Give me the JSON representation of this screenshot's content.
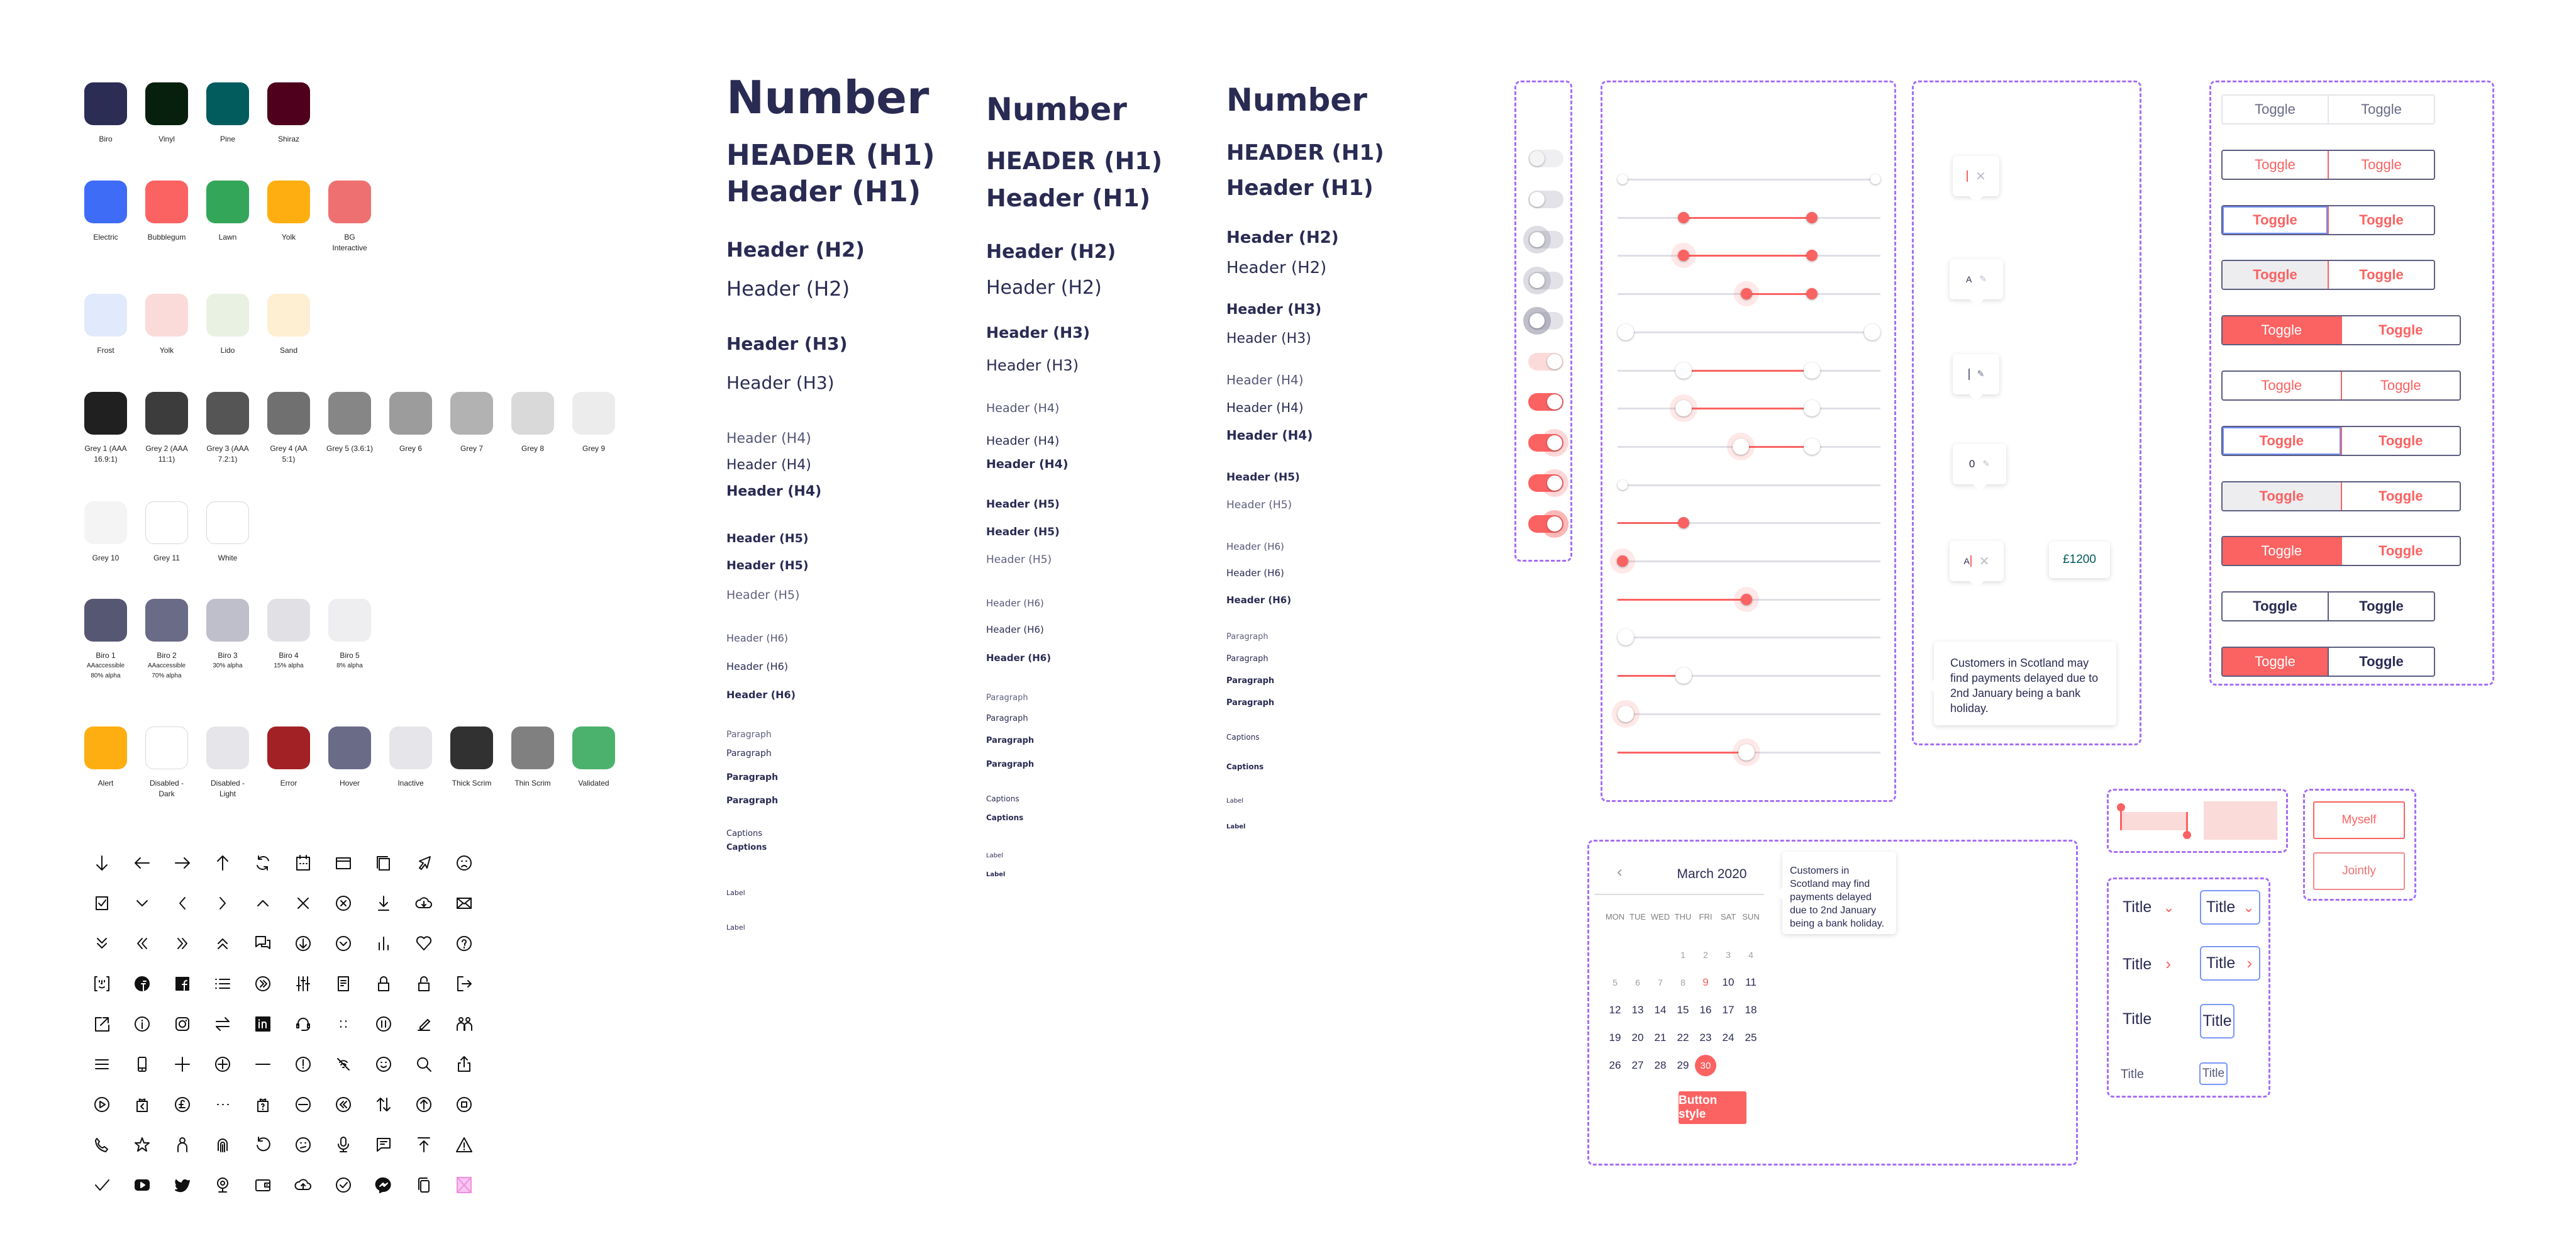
{
  "palette": {
    "brand": [
      {
        "name": "Biro",
        "color": "#2b2d54"
      },
      {
        "name": "Vinyl",
        "color": "#07200d"
      },
      {
        "name": "Pine",
        "color": "#025b5d"
      },
      {
        "name": "Shiraz",
        "color": "#4f001d"
      }
    ],
    "accents": [
      {
        "name": "Electric",
        "color": "#3e6cf7"
      },
      {
        "name": "Bubblegum",
        "color": "#fb6262"
      },
      {
        "name": "Lawn",
        "color": "#34a659"
      },
      {
        "name": "Yolk",
        "color": "#feae10"
      },
      {
        "name": "BG Interactive",
        "color": "#ee7070"
      }
    ],
    "tints": [
      {
        "name": "Frost",
        "color": "#e1e9fc"
      },
      {
        "name": "Yolk",
        "color": "#fadbd9"
      },
      {
        "name": "Lido",
        "color": "#e8f1e2"
      },
      {
        "name": "Sand",
        "color": "#feefd2"
      }
    ],
    "greys": [
      {
        "name": "Grey 1 (AAA 16.9:1)",
        "color": "#202020"
      },
      {
        "name": "Grey 2 (AAA 11:1)",
        "color": "#3c3c3c"
      },
      {
        "name": "Grey 3 (AAA 7.2:1)",
        "color": "#555555"
      },
      {
        "name": "Grey 4 (AA 5:1)",
        "color": "#707070"
      },
      {
        "name": "Grey 5 (3.6:1)",
        "color": "#868686"
      },
      {
        "name": "Grey 6",
        "color": "#9c9c9c"
      },
      {
        "name": "Grey 7",
        "color": "#b2b2b2"
      },
      {
        "name": "Grey 8",
        "color": "#d9d9d9"
      },
      {
        "name": "Grey 9",
        "color": "#ececec"
      }
    ],
    "greys2": [
      {
        "name": "Grey 10",
        "color": "#f4f4f4"
      },
      {
        "name": "Grey 11",
        "color": "#ffffff",
        "outline": true
      },
      {
        "name": "White",
        "color": "#ffffff",
        "outline": true
      }
    ],
    "biros": [
      {
        "name": "Biro 1",
        "sub1": "AAaccessible",
        "sub2": "80% alpha",
        "color": "#565873"
      },
      {
        "name": "Biro 2",
        "sub1": "AAaccessible",
        "sub2": "70% alpha",
        "color": "#6a6b87"
      },
      {
        "name": "Biro 3",
        "sub1": "30% alpha",
        "sub2": "",
        "color": "#bfbfcb"
      },
      {
        "name": "Biro 4",
        "sub1": "15% alpha",
        "sub2": "",
        "color": "#e0e0e5"
      },
      {
        "name": "Biro 5",
        "sub1": "8% alpha",
        "sub2": "",
        "color": "#eeeef1"
      }
    ],
    "states": [
      {
        "name": "Alert",
        "color": "#feae10"
      },
      {
        "name": "Disabled - Dark",
        "color": "#ffffff",
        "outline": true
      },
      {
        "name": "Disabled - Light",
        "color": "#e5e5ea"
      },
      {
        "name": "Error",
        "color": "#a22124"
      },
      {
        "name": "Hover",
        "color": "#6a6b87"
      },
      {
        "name": "Inactive",
        "color": "#e6e6ea"
      },
      {
        "name": "Thick Scrim",
        "color": "#313131"
      },
      {
        "name": "Thin Scrim",
        "color": "#808080"
      },
      {
        "name": "Validated",
        "color": "#4ab26c"
      }
    ]
  },
  "icons": [
    "arrow-down",
    "arrow-left",
    "arrow-right",
    "arrow-up",
    "refresh",
    "calendar",
    "browser-window",
    "copy-document",
    "cursor-pointer",
    "sad-face",
    "checkbox-checked",
    "chevron-down",
    "chevron-left",
    "chevron-right",
    "chevron-up",
    "close",
    "close-circle",
    "download",
    "cloud-download",
    "mail",
    "double-chevron-down",
    "double-chevron-left",
    "double-chevron-right",
    "double-chevron-up",
    "chat",
    "arrow-down-circle",
    "chevron-down-circle",
    "bar-chart",
    "heart",
    "help-circle",
    "face-id",
    "facebook-round",
    "facebook-square",
    "list",
    "double-chevron-right-circle",
    "sliders",
    "document",
    "lock",
    "unlock",
    "logout",
    "external-link",
    "info-circle",
    "instagram",
    "transfer",
    "linkedin",
    "headset",
    "drag-handle",
    "pause-circle",
    "edit",
    "users",
    "menu",
    "mobile",
    "plus",
    "plus-circle",
    "minus",
    "alert-circle",
    "contactless-off",
    "happy-face",
    "search",
    "share",
    "play-circle",
    "gift-back",
    "pound-circle",
    "more-horizontal",
    "gift-question",
    "minus-circle",
    "rewind-circle",
    "sort",
    "arrow-up-circle",
    "stop-circle",
    "phone",
    "star",
    "user",
    "fingerprint",
    "undo",
    "neutral-face",
    "microphone",
    "message",
    "upload-top",
    "warning",
    "check",
    "youtube",
    "twitter",
    "webcam",
    "wallet",
    "cloud-upload",
    "check-circle",
    "messenger",
    "duplicate",
    "placeholder"
  ],
  "typography": {
    "col1": [
      "Number",
      "HEADER (H1)",
      "Header (H1)",
      "Header (H2)",
      "Header (H2)",
      "Header (H3)",
      "Header (H3)",
      "Header (H4)",
      "Header (H4)",
      "Header (H4)",
      "Header (H5)",
      "Header (H5)",
      "Header (H5)",
      "Header (H6)",
      "Header (H6)",
      "Header (H6)",
      "Paragraph",
      "Paragraph",
      "Paragraph",
      "Paragraph",
      "Captions",
      "Captions",
      "Label",
      "Label"
    ],
    "col2": [
      "Number",
      "HEADER (H1)",
      "Header (H1)",
      "Header (H2)",
      "Header (H2)",
      "Header (H3)",
      "Header (H3)",
      "Header (H4)",
      "Header (H4)",
      "Header (H4)",
      "Header (H5)",
      "Header (H5)",
      "Header (H5)",
      "Header (H6)",
      "Header (H6)",
      "Header (H6)",
      "Paragraph",
      "Paragraph",
      "Paragraph",
      "Paragraph",
      "Captions",
      "Captions",
      "Label",
      "Label"
    ],
    "col3": [
      "Number",
      "HEADER (H1)",
      "Header (H1)",
      "Header (H2)",
      "Header (H2)",
      "Header (H3)",
      "Header (H3)",
      "Header (H4)",
      "Header (H4)",
      "Header (H4)",
      "Header (H5)",
      "Header (H5)",
      "Header (H6)",
      "Header (H6)",
      "Header (H6)",
      "Paragraph",
      "Paragraph",
      "Paragraph",
      "Paragraph",
      "Captions",
      "Captions",
      "Label",
      "Label"
    ]
  },
  "switches": [
    {
      "state": "off-disabled",
      "on": false
    },
    {
      "state": "off",
      "on": false
    },
    {
      "state": "off-hover",
      "on": false
    },
    {
      "state": "off-focus",
      "on": false
    },
    {
      "state": "off-pressed",
      "on": false
    },
    {
      "state": "on-disabled",
      "on": true
    },
    {
      "state": "on",
      "on": true
    },
    {
      "state": "on-hover",
      "on": true
    },
    {
      "state": "on-focus",
      "on": true
    },
    {
      "state": "on-pressed",
      "on": true
    }
  ],
  "sliders": [
    {
      "type": "range",
      "values": [
        0,
        1
      ],
      "style": "small-white"
    },
    {
      "type": "range",
      "values": [
        0.25,
        0.74
      ],
      "style": "small-red"
    },
    {
      "type": "range",
      "values": [
        0.25,
        0.74
      ],
      "style": "small-red-halo-left"
    },
    {
      "type": "range",
      "values": [
        0.49,
        0.74
      ],
      "style": "small-red-halo-left"
    },
    {
      "type": "range",
      "values": [
        0,
        1
      ],
      "style": "large-white"
    },
    {
      "type": "range",
      "values": [
        0.25,
        0.74
      ],
      "style": "large-white"
    },
    {
      "type": "range",
      "values": [
        0.25,
        0.74
      ],
      "style": "large-white-halo-left"
    },
    {
      "type": "range",
      "values": [
        0.47,
        0.74
      ],
      "style": "large-white-halo-left"
    },
    {
      "type": "single",
      "value": 0,
      "style": "small-white"
    },
    {
      "type": "single",
      "value": 0.25,
      "style": "small-red"
    },
    {
      "type": "single",
      "value": 0,
      "style": "small-red-halo"
    },
    {
      "type": "single",
      "value": 0.49,
      "style": "small-red-halo"
    },
    {
      "type": "single",
      "value": 0,
      "style": "large-white"
    },
    {
      "type": "single",
      "value": 0.25,
      "style": "large-white"
    },
    {
      "type": "single",
      "value": 0,
      "style": "large-white-halo"
    },
    {
      "type": "single",
      "value": 0.49,
      "style": "large-white-halo"
    }
  ],
  "value_tips": [
    {
      "text": "",
      "cursor": "red",
      "icon": "close"
    },
    {
      "text": "A",
      "cursor": "",
      "icon": "pencil"
    },
    {
      "text": "",
      "cursor": "grey",
      "icon": "pencil"
    },
    {
      "text": "0",
      "cursor": "",
      "icon": "pencil"
    },
    {
      "text": "A",
      "cursor": "red",
      "icon": "close"
    }
  ],
  "amount_tip": "£1200",
  "info_tip": "Customers in Scotland may find payments delayed due to 2nd January being a bank holiday.",
  "toggle_groups": [
    {
      "left": "Toggle",
      "right": "Toggle",
      "style": "disabled"
    },
    {
      "left": "Toggle",
      "right": "Toggle",
      "style": "default"
    },
    {
      "left": "Toggle",
      "right": "Toggle",
      "style": "focus-left"
    },
    {
      "left": "Toggle",
      "right": "Toggle",
      "style": "hover-left"
    },
    {
      "left": "Toggle",
      "right": "Toggle",
      "style": "selected-left",
      "wide": true
    },
    {
      "left": "Toggle",
      "right": "Toggle",
      "style": "default",
      "wide": true
    },
    {
      "left": "Toggle",
      "right": "Toggle",
      "style": "focus-left",
      "wide": true
    },
    {
      "left": "Toggle",
      "right": "Toggle",
      "style": "hover-left",
      "wide": true
    },
    {
      "left": "Toggle",
      "right": "Toggle",
      "style": "selected-left",
      "wide": true
    },
    {
      "left": "Toggle",
      "right": "Toggle",
      "style": "dark"
    },
    {
      "left": "Toggle",
      "right": "Toggle",
      "style": "selected-dark"
    }
  ],
  "calendar": {
    "month": "March 2020",
    "weekdays": [
      "MON",
      "TUE",
      "WED",
      "THU",
      "FRI",
      "SAT",
      "SUN"
    ],
    "leading_blanks": 3,
    "days": [
      1,
      2,
      3,
      4,
      5,
      6,
      7,
      8,
      9,
      10,
      11,
      12,
      13,
      14,
      15,
      16,
      17,
      18,
      19,
      20,
      21,
      22,
      23,
      24,
      25,
      26,
      27,
      28,
      29,
      30
    ],
    "disabled_through": 8,
    "today": 9,
    "selected": 30,
    "button": "Button style",
    "tip": "Customers in Scotland may find payments delayed due to 2nd January being a bank holiday."
  },
  "choice_buttons": [
    "Myself",
    "Jointly"
  ],
  "titles": {
    "plain": [
      "Title",
      "Title",
      "Title",
      "Title"
    ],
    "boxed": [
      "Title",
      "Title",
      "Title",
      "Title"
    ]
  },
  "colors": {
    "accent": "#fb6262",
    "ink": "#2a2b53",
    "frame": "#a66ef5",
    "focus": "#6f8ef5"
  }
}
